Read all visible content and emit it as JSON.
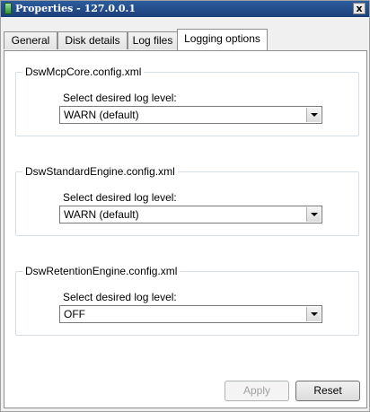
{
  "window": {
    "title": "Properties - 127.0.0.1",
    "close_glyph": "x"
  },
  "tabs": [
    {
      "label": "General"
    },
    {
      "label": "Disk details"
    },
    {
      "label": "Log files"
    },
    {
      "label": "Logging options",
      "active": true
    }
  ],
  "groups": [
    {
      "title": "DswMcpCore.config.xml",
      "prompt": "Select desired log level:",
      "selected": "WARN (default)"
    },
    {
      "title": "DswStandardEngine.config.xml",
      "prompt": "Select desired log level:",
      "selected": "WARN (default)"
    },
    {
      "title": "DswRetentionEngine.config.xml",
      "prompt": "Select desired log level:",
      "selected": "OFF"
    }
  ],
  "buttons": {
    "apply": "Apply",
    "apply_enabled": false,
    "reset": "Reset"
  },
  "icons": {
    "app": "server-icon",
    "close": "close-icon",
    "dropdown": "chevron-down-icon"
  }
}
